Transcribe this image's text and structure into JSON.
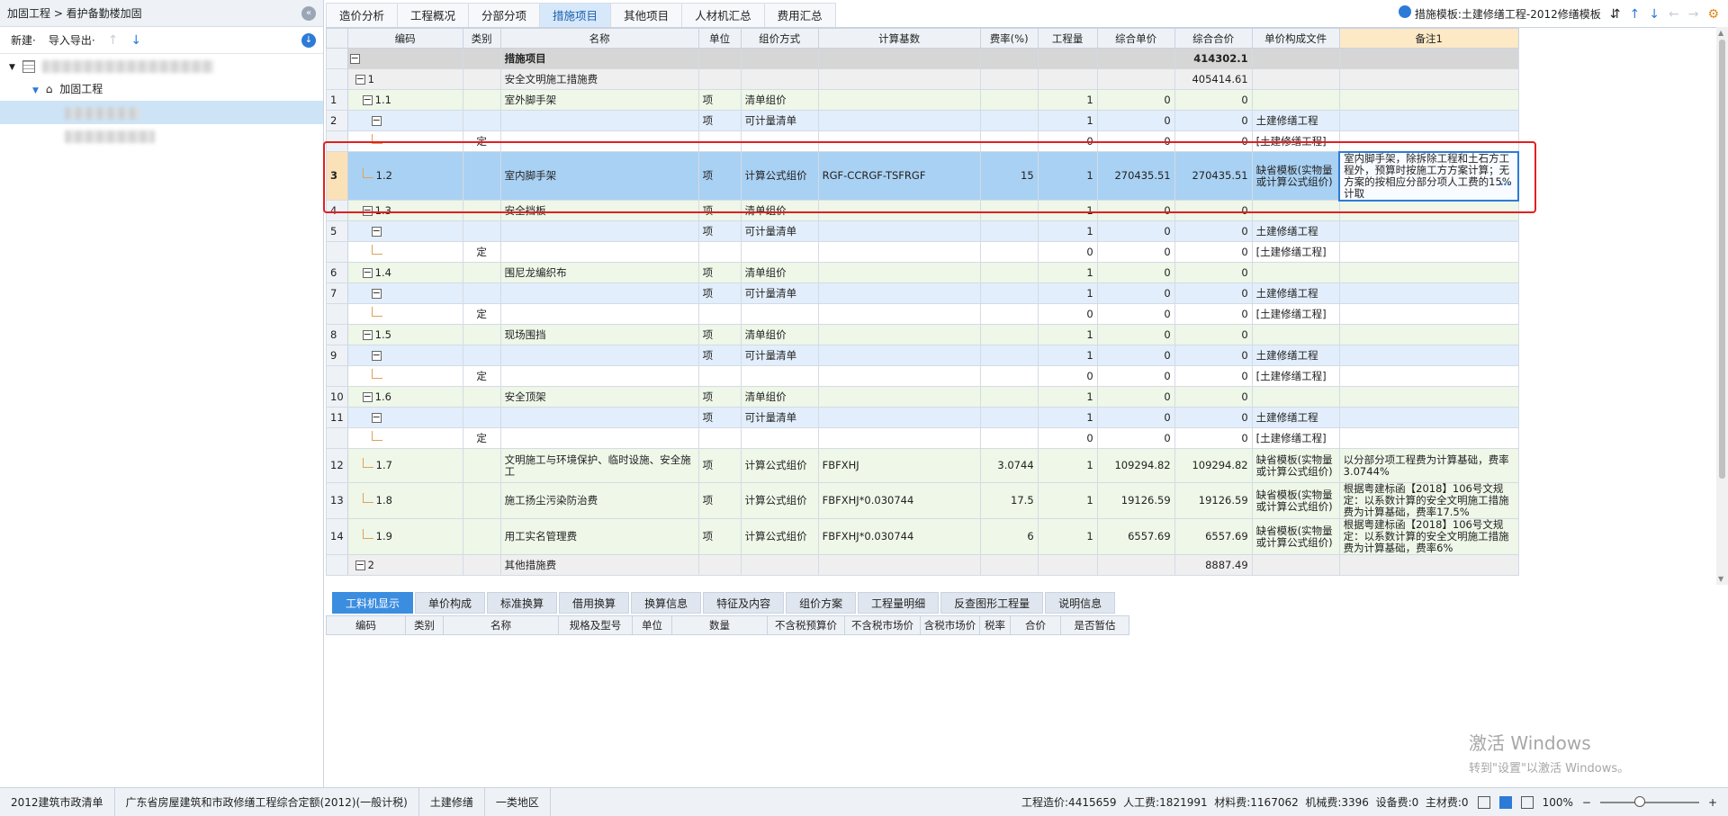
{
  "left_panel": {
    "breadcrumb": "加固工程 > 看护备勤楼加固",
    "toolbar": {
      "new_label": "新建·",
      "import_export_label": "导入导出·"
    },
    "tree": {
      "child_label": "加固工程"
    }
  },
  "tabs": [
    "造价分析",
    "工程概况",
    "分部分项",
    "措施项目",
    "其他项目",
    "人材机汇总",
    "费用汇总"
  ],
  "active_tab": "措施项目",
  "template_label": "措施模板:土建修缮工程-2012修缮模板",
  "grid": {
    "headers": [
      "编码",
      "类别",
      "名称",
      "单位",
      "组价方式",
      "计算基数",
      "费率(%)",
      "工程量",
      "综合单价",
      "综合合价",
      "单价构成文件",
      "备注1"
    ],
    "rows": [
      {
        "rn": "",
        "code": "",
        "toggle": "−",
        "cat": "",
        "name": "措施项目",
        "unit": "",
        "method": "",
        "base": "",
        "rate": "",
        "qty": "",
        "price": "",
        "total": "414302.1",
        "file": "",
        "note": "",
        "cls": "lv0",
        "bold": true
      },
      {
        "rn": "",
        "code": "1",
        "toggle": "−",
        "cat": "",
        "name": "安全文明施工措施费",
        "unit": "",
        "method": "",
        "base": "",
        "rate": "",
        "qty": "",
        "price": "",
        "total": "405414.61",
        "file": "",
        "note": "",
        "cls": "lv1"
      },
      {
        "rn": "1",
        "code": "1.1",
        "toggle": "−",
        "cat": "",
        "name": "室外脚手架",
        "unit": "项",
        "method": "清单组价",
        "base": "",
        "rate": "",
        "qty": "1",
        "price": "0",
        "total": "0",
        "file": "",
        "note": "",
        "cls": "lv2"
      },
      {
        "rn": "2",
        "code": "",
        "toggle": "−",
        "cat": "",
        "name": "",
        "unit": "项",
        "method": "可计量清单",
        "base": "",
        "rate": "",
        "qty": "1",
        "price": "0",
        "total": "0",
        "file": "土建修缮工程",
        "note": "",
        "cls": "lv3"
      },
      {
        "rn": "",
        "code": "",
        "toggle": "",
        "cat": "定",
        "name": "",
        "unit": "",
        "method": "",
        "base": "",
        "rate": "",
        "qty": "0",
        "price": "0",
        "total": "0",
        "file": "[土建修缮工程]",
        "note": "",
        "cls": "dg"
      },
      {
        "rn": "3",
        "code": "1.2",
        "toggle": "",
        "cat": "",
        "name": "室内脚手架",
        "unit": "项",
        "method": "计算公式组价",
        "base": "RGF-CCRGF-TSFRGF",
        "rate": "15",
        "qty": "1",
        "price": "270435.51",
        "total": "270435.51",
        "file": "缺省模板(实物量或计算公式组价)",
        "note": "室内脚手架，除拆除工程和土石方工程外，预算时按施工方方案计算；无方案的按相应分部分项人工费的15%计取",
        "cls": "sel"
      },
      {
        "rn": "4",
        "code": "1.3",
        "toggle": "−",
        "cat": "",
        "name": "安全挡板",
        "unit": "项",
        "method": "清单组价",
        "base": "",
        "rate": "",
        "qty": "1",
        "price": "0",
        "total": "0",
        "file": "",
        "note": "",
        "cls": "lv2"
      },
      {
        "rn": "5",
        "code": "",
        "toggle": "−",
        "cat": "",
        "name": "",
        "unit": "项",
        "method": "可计量清单",
        "base": "",
        "rate": "",
        "qty": "1",
        "price": "0",
        "total": "0",
        "file": "土建修缮工程",
        "note": "",
        "cls": "lv3"
      },
      {
        "rn": "",
        "code": "",
        "toggle": "",
        "cat": "定",
        "name": "",
        "unit": "",
        "method": "",
        "base": "",
        "rate": "",
        "qty": "0",
        "price": "0",
        "total": "0",
        "file": "[土建修缮工程]",
        "note": "",
        "cls": "dg"
      },
      {
        "rn": "6",
        "code": "1.4",
        "toggle": "−",
        "cat": "",
        "name": "围尼龙编织布",
        "unit": "项",
        "method": "清单组价",
        "base": "",
        "rate": "",
        "qty": "1",
        "price": "0",
        "total": "0",
        "file": "",
        "note": "",
        "cls": "lv2"
      },
      {
        "rn": "7",
        "code": "",
        "toggle": "−",
        "cat": "",
        "name": "",
        "unit": "项",
        "method": "可计量清单",
        "base": "",
        "rate": "",
        "qty": "1",
        "price": "0",
        "total": "0",
        "file": "土建修缮工程",
        "note": "",
        "cls": "lv3"
      },
      {
        "rn": "",
        "code": "",
        "toggle": "",
        "cat": "定",
        "name": "",
        "unit": "",
        "method": "",
        "base": "",
        "rate": "",
        "qty": "0",
        "price": "0",
        "total": "0",
        "file": "[土建修缮工程]",
        "note": "",
        "cls": "dg"
      },
      {
        "rn": "8",
        "code": "1.5",
        "toggle": "−",
        "cat": "",
        "name": "现场围挡",
        "unit": "项",
        "method": "清单组价",
        "base": "",
        "rate": "",
        "qty": "1",
        "price": "0",
        "total": "0",
        "file": "",
        "note": "",
        "cls": "lv2"
      },
      {
        "rn": "9",
        "code": "",
        "toggle": "−",
        "cat": "",
        "name": "",
        "unit": "项",
        "method": "可计量清单",
        "base": "",
        "rate": "",
        "qty": "1",
        "price": "0",
        "total": "0",
        "file": "土建修缮工程",
        "note": "",
        "cls": "lv3"
      },
      {
        "rn": "",
        "code": "",
        "toggle": "",
        "cat": "定",
        "name": "",
        "unit": "",
        "method": "",
        "base": "",
        "rate": "",
        "qty": "0",
        "price": "0",
        "total": "0",
        "file": "[土建修缮工程]",
        "note": "",
        "cls": "dg"
      },
      {
        "rn": "10",
        "code": "1.6",
        "toggle": "−",
        "cat": "",
        "name": "安全顶架",
        "unit": "项",
        "method": "清单组价",
        "base": "",
        "rate": "",
        "qty": "1",
        "price": "0",
        "total": "0",
        "file": "",
        "note": "",
        "cls": "lv2"
      },
      {
        "rn": "11",
        "code": "",
        "toggle": "−",
        "cat": "",
        "name": "",
        "unit": "项",
        "method": "可计量清单",
        "base": "",
        "rate": "",
        "qty": "1",
        "price": "0",
        "total": "0",
        "file": "土建修缮工程",
        "note": "",
        "cls": "lv3"
      },
      {
        "rn": "",
        "code": "",
        "toggle": "",
        "cat": "定",
        "name": "",
        "unit": "",
        "method": "",
        "base": "",
        "rate": "",
        "qty": "0",
        "price": "0",
        "total": "0",
        "file": "[土建修缮工程]",
        "note": "",
        "cls": "dg"
      },
      {
        "rn": "12",
        "code": "1.7",
        "toggle": "",
        "cat": "",
        "name": "文明施工与环境保护、临时设施、安全施工",
        "unit": "项",
        "method": "计算公式组价",
        "base": "FBFXHJ",
        "rate": "3.0744",
        "qty": "1",
        "price": "109294.82",
        "total": "109294.82",
        "file": "缺省模板(实物量或计算公式组价)",
        "note": "以分部分项工程费为计算基础，费率3.0744%",
        "cls": "lv2"
      },
      {
        "rn": "13",
        "code": "1.8",
        "toggle": "",
        "cat": "",
        "name": "施工扬尘污染防治费",
        "unit": "项",
        "method": "计算公式组价",
        "base": "FBFXHJ*0.030744",
        "rate": "17.5",
        "qty": "1",
        "price": "19126.59",
        "total": "19126.59",
        "file": "缺省模板(实物量或计算公式组价)",
        "note": "根据粤建标函【2018】106号文规定：以系数计算的安全文明施工措施费为计算基础，费率17.5%",
        "cls": "lv2"
      },
      {
        "rn": "14",
        "code": "1.9",
        "toggle": "",
        "cat": "",
        "name": "用工实名管理费",
        "unit": "项",
        "method": "计算公式组价",
        "base": "FBFXHJ*0.030744",
        "rate": "6",
        "qty": "1",
        "price": "6557.69",
        "total": "6557.69",
        "file": "缺省模板(实物量或计算公式组价)",
        "note": "根据粤建标函【2018】106号文规定：以系数计算的安全文明施工措施费为计算基础，费率6%",
        "cls": "lv2"
      },
      {
        "rn": "",
        "code": "2",
        "toggle": "−",
        "cat": "",
        "name": "其他措施费",
        "unit": "",
        "method": "",
        "base": "",
        "rate": "",
        "qty": "",
        "price": "",
        "total": "8887.49",
        "file": "",
        "note": "",
        "cls": "lv1"
      }
    ]
  },
  "bottom_tabs": [
    "工料机显示",
    "单价构成",
    "标准换算",
    "借用换算",
    "换算信息",
    "特征及内容",
    "组价方案",
    "工程量明细",
    "反查图形工程量",
    "说明信息"
  ],
  "bottom_active": "工料机显示",
  "bottom_headers": [
    "编码",
    "类别",
    "名称",
    "规格及型号",
    "单位",
    "数量",
    "不含税预算价",
    "不含税市场价",
    "含税市场价",
    "税率",
    "合价",
    "是否暂估"
  ],
  "watermark": {
    "line1": "激活 Windows",
    "line2": "转到\"设置\"以激活 Windows。"
  },
  "status": {
    "segments": [
      "2012建筑市政清单",
      "广东省房屋建筑和市政修缮工程综合定额(2012)(一般计税)",
      "土建修缮",
      "一类地区"
    ],
    "summary": "工程造价:4415659  人工费:1821991  材料费:1167062  机械费:3396  设备费:0  主材费:0",
    "zoom": "100%"
  }
}
